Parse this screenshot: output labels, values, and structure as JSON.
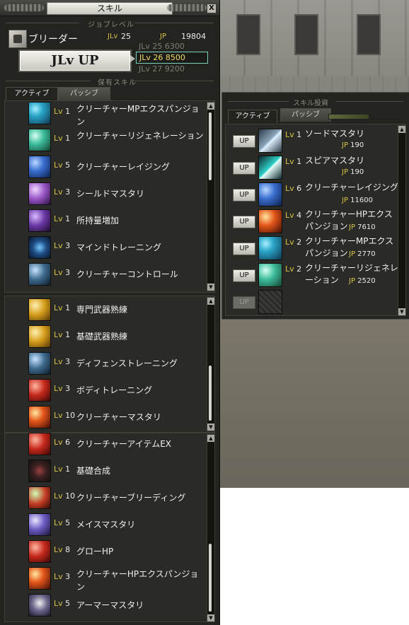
{
  "window": {
    "title": "スキル",
    "close_label": "X"
  },
  "job_level_section": "ジョブレベル",
  "owned_section": "保有スキル",
  "job": {
    "name": "ブリーダー",
    "jlv_label": "JLv",
    "jlv": "25",
    "jp_label": "JP",
    "jp": "19804"
  },
  "jlv_up_button": "JLv UP",
  "jlv_costs": [
    {
      "label": "JLv 25 6300",
      "selected": false
    },
    {
      "label": "JLv 26 8500",
      "selected": true
    },
    {
      "label": "JLv 27 9200",
      "selected": false
    }
  ],
  "tabs": {
    "active": "アクティブ",
    "passive": "パッシブ"
  },
  "active_skills": [
    {
      "lv": "Lv",
      "num": "1",
      "name": "クリーチャーMPエクスパンジョン",
      "icon": "creature-mp-icon"
    },
    {
      "lv": "Lv",
      "num": "1",
      "name": "クリーチャーリジェネレーション",
      "icon": "creature-regen-icon"
    },
    {
      "lv": "Lv",
      "num": "5",
      "name": "クリーチャーレイジング",
      "icon": "creature-raising-icon"
    },
    {
      "lv": "Lv",
      "num": "3",
      "name": "シールドマスタリ",
      "icon": "shield-mastery-icon"
    },
    {
      "lv": "Lv",
      "num": "1",
      "name": "所持量増加",
      "icon": "carry-capacity-icon"
    },
    {
      "lv": "Lv",
      "num": "3",
      "name": "マインドトレーニング",
      "icon": "mind-training-icon"
    },
    {
      "lv": "Lv",
      "num": "3",
      "name": "クリーチャーコントロール",
      "icon": "creature-control-icon"
    }
  ],
  "passive_skills_a": [
    {
      "lv": "Lv",
      "num": "1",
      "name": "専門武器熟練",
      "icon": "special-weapon-icon"
    },
    {
      "lv": "Lv",
      "num": "1",
      "name": "基礎武器熟練",
      "icon": "basic-weapon-icon"
    },
    {
      "lv": "Lv",
      "num": "3",
      "name": "ディフェンストレーニング",
      "icon": "defense-training-icon"
    },
    {
      "lv": "Lv",
      "num": "3",
      "name": "ボディトレーニング",
      "icon": "body-training-icon"
    },
    {
      "lv": "Lv",
      "num": "10",
      "name": "クリーチャーマスタリ",
      "icon": "creature-mastery-icon"
    }
  ],
  "passive_skills_b": [
    {
      "lv": "Lv",
      "num": "6",
      "name": "クリーチャーアイテムEX",
      "icon": "creature-item-icon"
    },
    {
      "lv": "Lv",
      "num": "1",
      "name": "基礎合成",
      "icon": "basic-synthesis-icon"
    },
    {
      "lv": "Lv",
      "num": "10",
      "name": "クリーチャーブリーディング",
      "icon": "creature-breeding-icon"
    },
    {
      "lv": "Lv",
      "num": "5",
      "name": "メイスマスタリ",
      "icon": "mace-mastery-icon"
    },
    {
      "lv": "Lv",
      "num": "8",
      "name": "グローHP",
      "icon": "grow-hp-icon"
    },
    {
      "lv": "Lv",
      "num": "3",
      "name": "クリーチャーHPエクスパンジョン",
      "icon": "creature-hp-icon"
    },
    {
      "lv": "Lv",
      "num": "5",
      "name": "アーマーマスタリ",
      "icon": "armor-mastery-icon"
    }
  ],
  "invest": {
    "title": "スキル投資",
    "tabs": {
      "active": "アクティブ",
      "passive": "パッシブ"
    },
    "up_label": "UP",
    "jp_label": "JP",
    "rows": [
      {
        "lv": "Lv",
        "num": "1",
        "name": "ソードマスタリ",
        "jp": "190",
        "icon": "sword-mastery-icon"
      },
      {
        "lv": "Lv",
        "num": "1",
        "name": "スピアマスタリ",
        "jp": "190",
        "icon": "spear-mastery-icon"
      },
      {
        "lv": "Lv",
        "num": "6",
        "name": "クリーチャーレイジング",
        "jp": "11600",
        "icon": "creature-raising-icon"
      },
      {
        "lv": "Lv",
        "num": "4",
        "name": "クリーチャーHPエクスパンジョン",
        "jp": "7610",
        "icon": "creature-hp-icon"
      },
      {
        "lv": "Lv",
        "num": "2",
        "name": "クリーチャーMPエクスパンジョン",
        "jp": "2770",
        "icon": "creature-mp-icon"
      },
      {
        "lv": "Lv",
        "num": "2",
        "name": "クリーチャーリジェネレーション",
        "jp": "2520",
        "icon": "creature-regen-icon"
      }
    ]
  },
  "colors": {
    "accent": "#d6c34a",
    "panel": "#2a2b26",
    "selected_border": "#7ed0c0"
  }
}
